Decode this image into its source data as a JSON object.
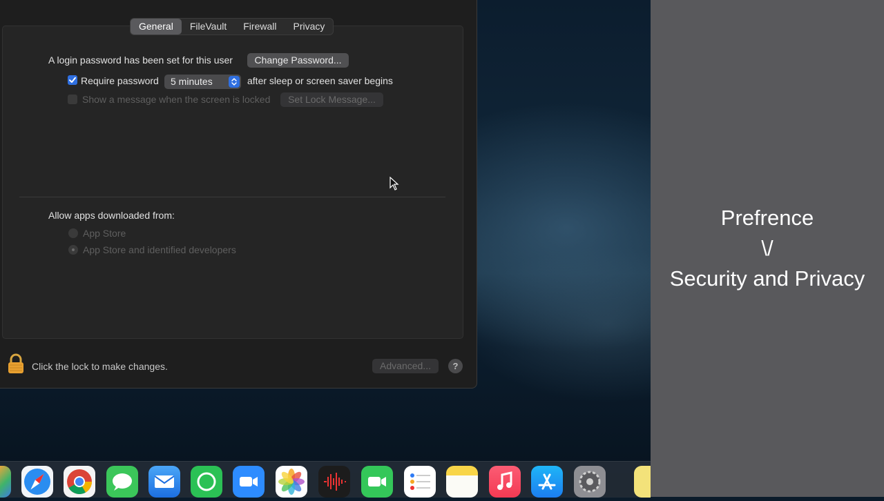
{
  "window": {
    "tabs": [
      {
        "label": "General",
        "active": true
      },
      {
        "label": "FileVault",
        "active": false
      },
      {
        "label": "Firewall",
        "active": false
      },
      {
        "label": "Privacy",
        "active": false
      }
    ],
    "general": {
      "login_text": "A login password has been set for this user",
      "change_password_label": "Change Password...",
      "require_password_label": "Require password",
      "require_password_checked": true,
      "require_password_interval": "5 minutes",
      "after_sleep_text": "after sleep or screen saver begins",
      "show_message_label": "Show a message when the screen is locked",
      "show_message_checked": false,
      "set_lock_message_label": "Set Lock Message...",
      "allow_apps_label": "Allow apps downloaded from:",
      "radio_options": [
        {
          "label": "App Store",
          "selected": false
        },
        {
          "label": "App Store and identified developers",
          "selected": true
        }
      ]
    },
    "footer": {
      "lock_text": "Click the lock to make changes.",
      "advanced_label": "Advanced...",
      "help_label": "?"
    }
  },
  "dock": {
    "apps": [
      "launchpad-icon",
      "safari-icon",
      "chrome-icon",
      "messages-icon",
      "mail-icon",
      "whatsapp-icon",
      "zoom-icon",
      "photos-icon",
      "voice-memos-icon",
      "facetime-icon",
      "reminders-icon",
      "notes-icon",
      "music-icon",
      "app-store-icon",
      "system-preferences-icon",
      "stickies-icon"
    ]
  },
  "side_panel": {
    "line1": "Prefrence",
    "line2": "\\/",
    "line3": "Security and Privacy"
  },
  "colors": {
    "accent": "#2f6fe0",
    "window_bg": "#1e1e1e",
    "panel_bg": "#59595c"
  }
}
